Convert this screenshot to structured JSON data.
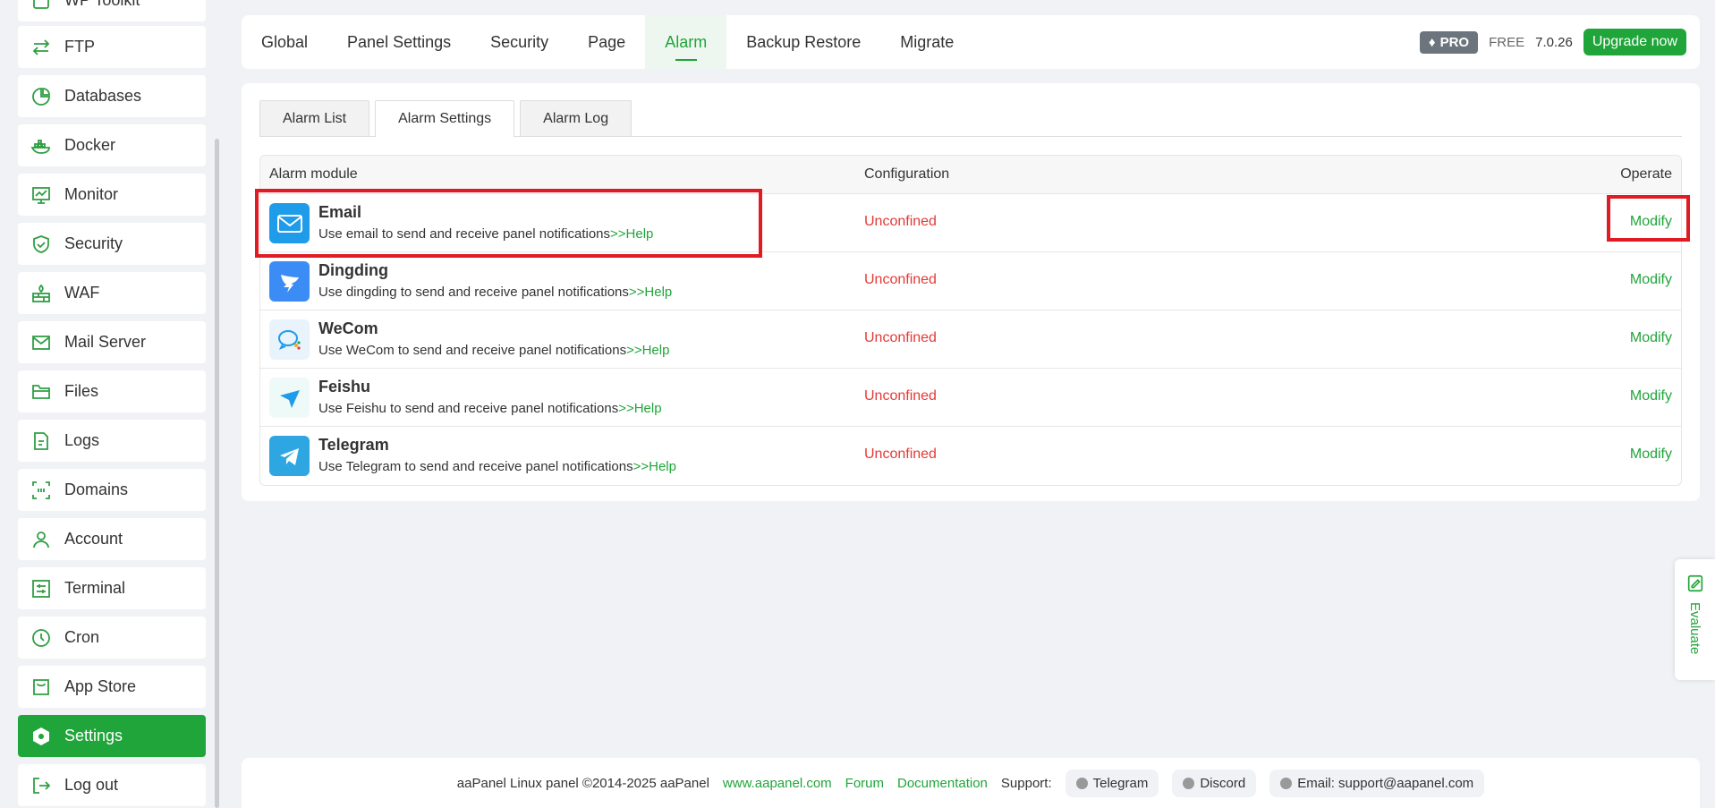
{
  "sidebar": {
    "items": [
      {
        "label": "WP Toolkit",
        "icon": "toolkit-icon"
      },
      {
        "label": "FTP",
        "icon": "transfer-icon"
      },
      {
        "label": "Databases",
        "icon": "pie-chart-icon"
      },
      {
        "label": "Docker",
        "icon": "docker-icon"
      },
      {
        "label": "Monitor",
        "icon": "monitor-icon"
      },
      {
        "label": "Security",
        "icon": "shield-icon"
      },
      {
        "label": "WAF",
        "icon": "firewall-icon"
      },
      {
        "label": "Mail Server",
        "icon": "mail-icon"
      },
      {
        "label": "Files",
        "icon": "folder-icon"
      },
      {
        "label": "Logs",
        "icon": "log-icon"
      },
      {
        "label": "Domains",
        "icon": "domain-icon"
      },
      {
        "label": "Account",
        "icon": "user-icon"
      },
      {
        "label": "Terminal",
        "icon": "terminal-icon"
      },
      {
        "label": "Cron",
        "icon": "clock-icon"
      },
      {
        "label": "App Store",
        "icon": "store-icon"
      },
      {
        "label": "Settings",
        "icon": "settings-icon",
        "active": true
      },
      {
        "label": "Log out",
        "icon": "logout-icon"
      }
    ]
  },
  "topnav": {
    "tabs": [
      "Global",
      "Panel Settings",
      "Security",
      "Page",
      "Alarm",
      "Backup Restore",
      "Migrate"
    ],
    "active_tab": "Alarm",
    "pro_label": "PRO",
    "free_label": "FREE",
    "version": "7.0.26",
    "upgrade_label": "Upgrade now"
  },
  "subtabs": {
    "items": [
      "Alarm List",
      "Alarm Settings",
      "Alarm Log"
    ],
    "active": "Alarm Settings"
  },
  "table": {
    "headers": {
      "module": "Alarm module",
      "config": "Configuration",
      "operate": "Operate"
    },
    "rows": [
      {
        "name": "Email",
        "desc": "Use email to send and receive panel notifications",
        "help": ">>Help",
        "status": "Unconfined",
        "action": "Modify",
        "icon": "email-icon",
        "color": "#1e9be9"
      },
      {
        "name": "Dingding",
        "desc": "Use dingding to send and receive panel notifications",
        "help": ">>Help",
        "status": "Unconfined",
        "action": "Modify",
        "icon": "dingding-icon",
        "color": "#3b8df5"
      },
      {
        "name": "WeCom",
        "desc": "Use WeCom to send and receive panel notifications",
        "help": ">>Help",
        "status": "Unconfined",
        "action": "Modify",
        "icon": "wecom-icon",
        "color": "#e8f3fc"
      },
      {
        "name": "Feishu",
        "desc": "Use Feishu to send and receive panel notifications",
        "help": ">>Help",
        "status": "Unconfined",
        "action": "Modify",
        "icon": "feishu-icon",
        "color": "#eefaf8"
      },
      {
        "name": "Telegram",
        "desc": "Use Telegram to send and receive panel notifications",
        "help": ">>Help",
        "status": "Unconfined",
        "action": "Modify",
        "icon": "telegram-icon",
        "color": "#2ea6e2"
      }
    ]
  },
  "footer": {
    "copyright": "aaPanel Linux panel ©2014-2025 aaPanel",
    "website": "www.aapanel.com",
    "forum": "Forum",
    "docs": "Documentation",
    "support_label": "Support:",
    "telegram": "Telegram",
    "discord": "Discord",
    "email": "Email: support@aapanel.com"
  },
  "evaluate": {
    "label": "Evaluate"
  },
  "colors": {
    "accent": "#20a53a",
    "error": "#e53935",
    "highlight": "#e01b24"
  }
}
